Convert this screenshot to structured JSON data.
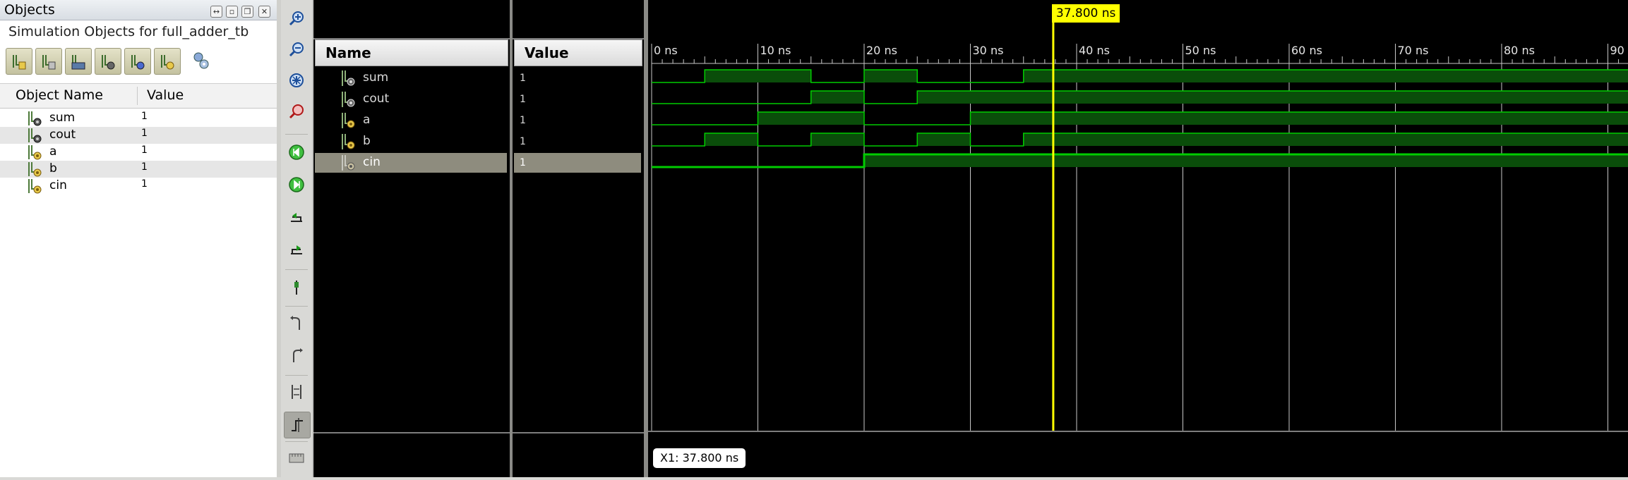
{
  "objects_panel": {
    "title": "Objects",
    "subtitle": "Simulation Objects for full_adder_tb",
    "columns": {
      "name": "Object Name",
      "value": "Value"
    },
    "rows": [
      {
        "name": "sum",
        "value": "1",
        "kind": "output"
      },
      {
        "name": "cout",
        "value": "1",
        "kind": "output"
      },
      {
        "name": "a",
        "value": "1",
        "kind": "input"
      },
      {
        "name": "b",
        "value": "1",
        "kind": "input"
      },
      {
        "name": "cin",
        "value": "1",
        "kind": "input"
      }
    ],
    "toolbar_icons": [
      "input-filter-icon",
      "output-filter-icon",
      "bidirectional-filter-icon",
      "internal-filter-icon",
      "constant-filter-icon",
      "variable-filter-icon",
      "settings-icon"
    ],
    "window_icons": [
      "restore-icon",
      "minimize-icon",
      "maximize-icon",
      "close-icon"
    ]
  },
  "wave_toolbar": {
    "icons": [
      "zoom-in-icon",
      "zoom-out-icon",
      "zoom-fit-icon",
      "zoom-cursor-icon",
      "go-to-start-icon",
      "go-to-end-icon",
      "previous-transition-icon",
      "next-transition-icon",
      "add-marker-icon",
      "previous-marker-icon",
      "next-marker-icon",
      "swap-cursors-icon",
      "snap-to-transition-icon",
      "float-ruler-icon"
    ]
  },
  "wave_window": {
    "columns": {
      "name": "Name",
      "value": "Value"
    },
    "signals": [
      {
        "name": "sum",
        "value": "1",
        "kind": "output",
        "selected": false
      },
      {
        "name": "cout",
        "value": "1",
        "kind": "output",
        "selected": false
      },
      {
        "name": "a",
        "value": "1",
        "kind": "input",
        "selected": false
      },
      {
        "name": "b",
        "value": "1",
        "kind": "input",
        "selected": false
      },
      {
        "name": "cin",
        "value": "1",
        "kind": "input",
        "selected": true
      }
    ],
    "timeline": {
      "unit": "ns",
      "labels": [
        "0 ns",
        "10 ns",
        "20 ns",
        "30 ns",
        "40 ns",
        "50 ns",
        "60 ns",
        "70 ns",
        "80 ns",
        "90 ns"
      ],
      "max_ns": 92
    },
    "waveforms": {
      "sum": [
        [
          0,
          0
        ],
        [
          5,
          1
        ],
        [
          15,
          0
        ],
        [
          20,
          1
        ],
        [
          25,
          0
        ],
        [
          35,
          1
        ]
      ],
      "cout": [
        [
          0,
          0
        ],
        [
          15,
          1
        ],
        [
          20,
          0
        ],
        [
          25,
          1
        ]
      ],
      "a": [
        [
          0,
          0
        ],
        [
          10,
          1
        ],
        [
          20,
          0
        ],
        [
          30,
          1
        ]
      ],
      "b": [
        [
          0,
          0
        ],
        [
          5,
          1
        ],
        [
          10,
          0
        ],
        [
          15,
          1
        ],
        [
          20,
          0
        ],
        [
          25,
          1
        ],
        [
          30,
          0
        ],
        [
          35,
          1
        ]
      ],
      "cin": [
        [
          0,
          0
        ],
        [
          20,
          1
        ]
      ]
    },
    "cursor": {
      "time_ns": 37.8,
      "flag_label": "37.800 ns",
      "readout_label": "X1: 37.800 ns"
    }
  },
  "colors": {
    "wave_line": "#00cc00",
    "wave_fill": "#0a4d0a",
    "cursor": "#ffff00",
    "grid": "#c8c8c8",
    "selected_row": "#8e8c7e"
  }
}
